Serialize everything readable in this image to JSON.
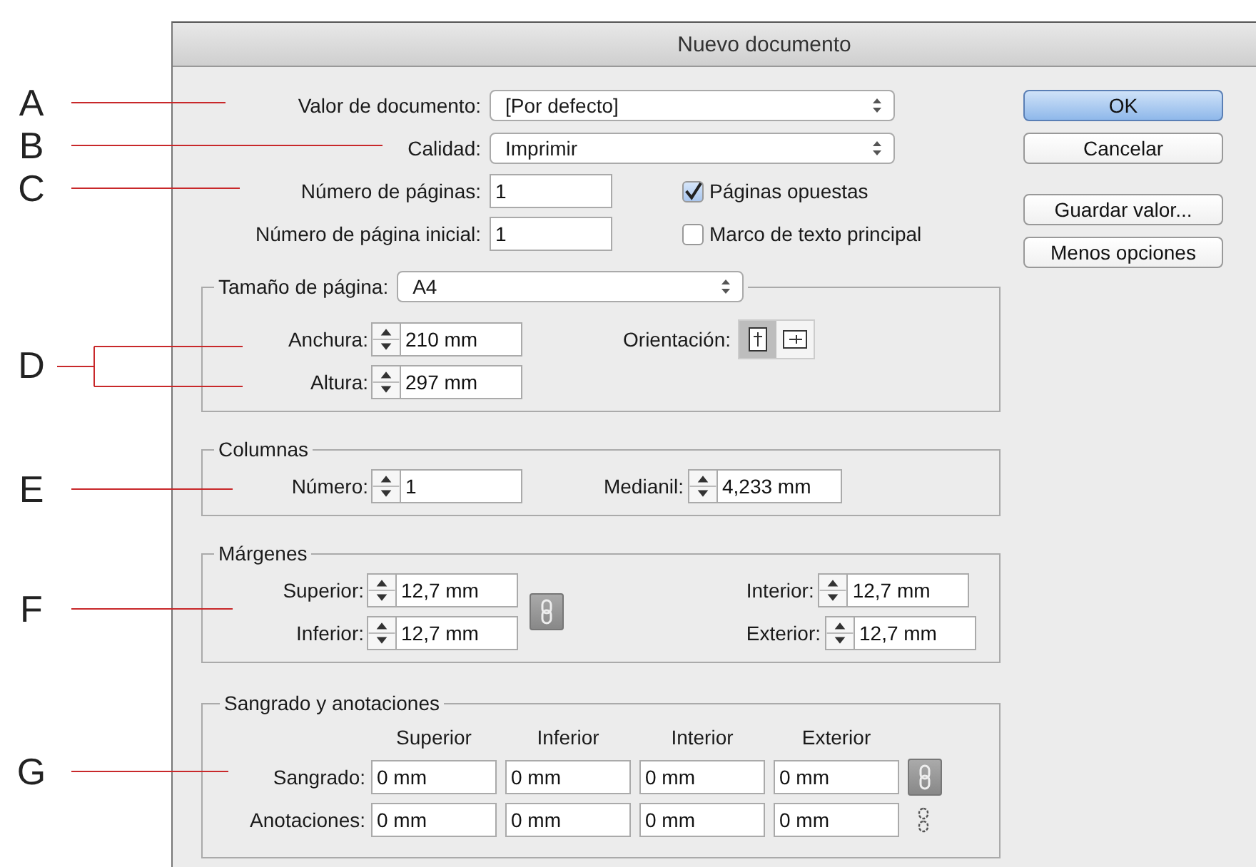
{
  "window": {
    "title": "Nuevo documento"
  },
  "annotations": [
    {
      "letter": "A",
      "kind": "line"
    },
    {
      "letter": "B",
      "kind": "line"
    },
    {
      "letter": "C",
      "kind": "line"
    },
    {
      "letter": "D",
      "kind": "bracket"
    },
    {
      "letter": "E",
      "kind": "line"
    },
    {
      "letter": "F",
      "kind": "line"
    },
    {
      "letter": "G",
      "kind": "line"
    }
  ],
  "document_preset": {
    "label": "Valor de documento:",
    "value": "[Por defecto]"
  },
  "quality": {
    "label": "Calidad:",
    "value": "Imprimir"
  },
  "pages": {
    "label": "Número de páginas:",
    "value": "1"
  },
  "start_page": {
    "label": "Número de página inicial:",
    "value": "1"
  },
  "checkboxes": [
    {
      "label": "Páginas opuestas",
      "checked": true
    },
    {
      "label": "Marco de texto principal",
      "checked": false
    }
  ],
  "page_size": {
    "label": "Tamaño de página:",
    "value": "A4",
    "width": {
      "label": "Anchura:",
      "value": "210 mm"
    },
    "height": {
      "label": "Altura:",
      "value": "297 mm"
    },
    "orientation": {
      "label": "Orientación:",
      "options": [
        {
          "kind": "portrait",
          "selected": true
        },
        {
          "kind": "landscape",
          "selected": false
        }
      ]
    }
  },
  "columns": {
    "title": "Columnas",
    "number": {
      "label": "Número:",
      "value": "1"
    },
    "gutter": {
      "label": "Medianil:",
      "value": "4,233 mm"
    }
  },
  "margins": {
    "title": "Márgenes",
    "linked": true,
    "fields": [
      {
        "label": "Superior:",
        "value": "12,7 mm"
      },
      {
        "label": "Inferior:",
        "value": "12,7 mm"
      },
      {
        "label": "Interior:",
        "value": "12,7 mm"
      },
      {
        "label": "Exterior:",
        "value": "12,7 mm"
      }
    ]
  },
  "bleed": {
    "title": "Sangrado y anotaciones",
    "headers": [
      "Superior",
      "Inferior",
      "Interior",
      "Exterior"
    ],
    "rows": [
      {
        "label": "Sangrado:",
        "values": [
          "0 mm",
          "0 mm",
          "0 mm",
          "0 mm"
        ],
        "linked": true
      },
      {
        "label": "Anotaciones:",
        "values": [
          "0 mm",
          "0 mm",
          "0 mm",
          "0 mm"
        ],
        "linked": false
      }
    ]
  },
  "buttons": [
    {
      "label": "OK",
      "default": true
    },
    {
      "label": "Cancelar",
      "default": false
    },
    {
      "label": "Guardar valor...",
      "default": false
    },
    {
      "label": "Menos opciones",
      "default": false
    }
  ]
}
